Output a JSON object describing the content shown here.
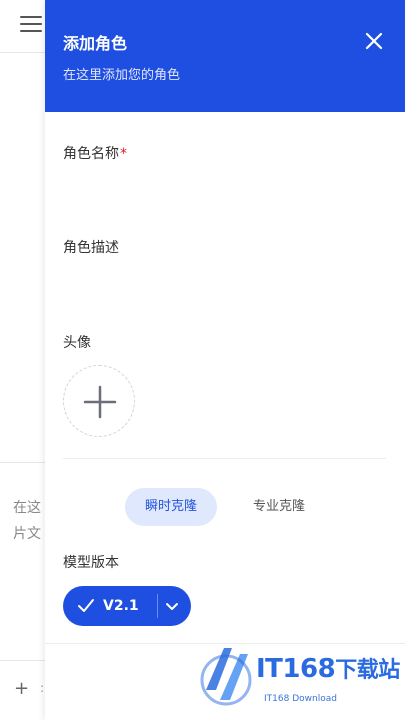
{
  "background": {
    "text_line1": "在这",
    "text_line2": "片文",
    "plus_symbol": "+",
    "colon": ":"
  },
  "drawer": {
    "title": "添加角色",
    "subtitle": "在这里添加您的角色",
    "close_icon": "close-icon",
    "fields": {
      "name_label": "角色名称",
      "required_mark": "*",
      "description_label": "角色描述",
      "avatar_label": "头像"
    },
    "tabs": [
      {
        "label": "瞬时克隆",
        "active": true
      },
      {
        "label": "专业克隆",
        "active": false
      }
    ],
    "model": {
      "label": "模型版本",
      "selected_version": "V2.1"
    }
  },
  "watermark": {
    "main": "IT168",
    "cn": "下载站",
    "sub": "IT168 Download"
  },
  "colors": {
    "primary": "#1f4fe0",
    "tab_active_bg": "#dfe8fd",
    "tab_active_text": "#2554d9",
    "required": "#e02020"
  }
}
